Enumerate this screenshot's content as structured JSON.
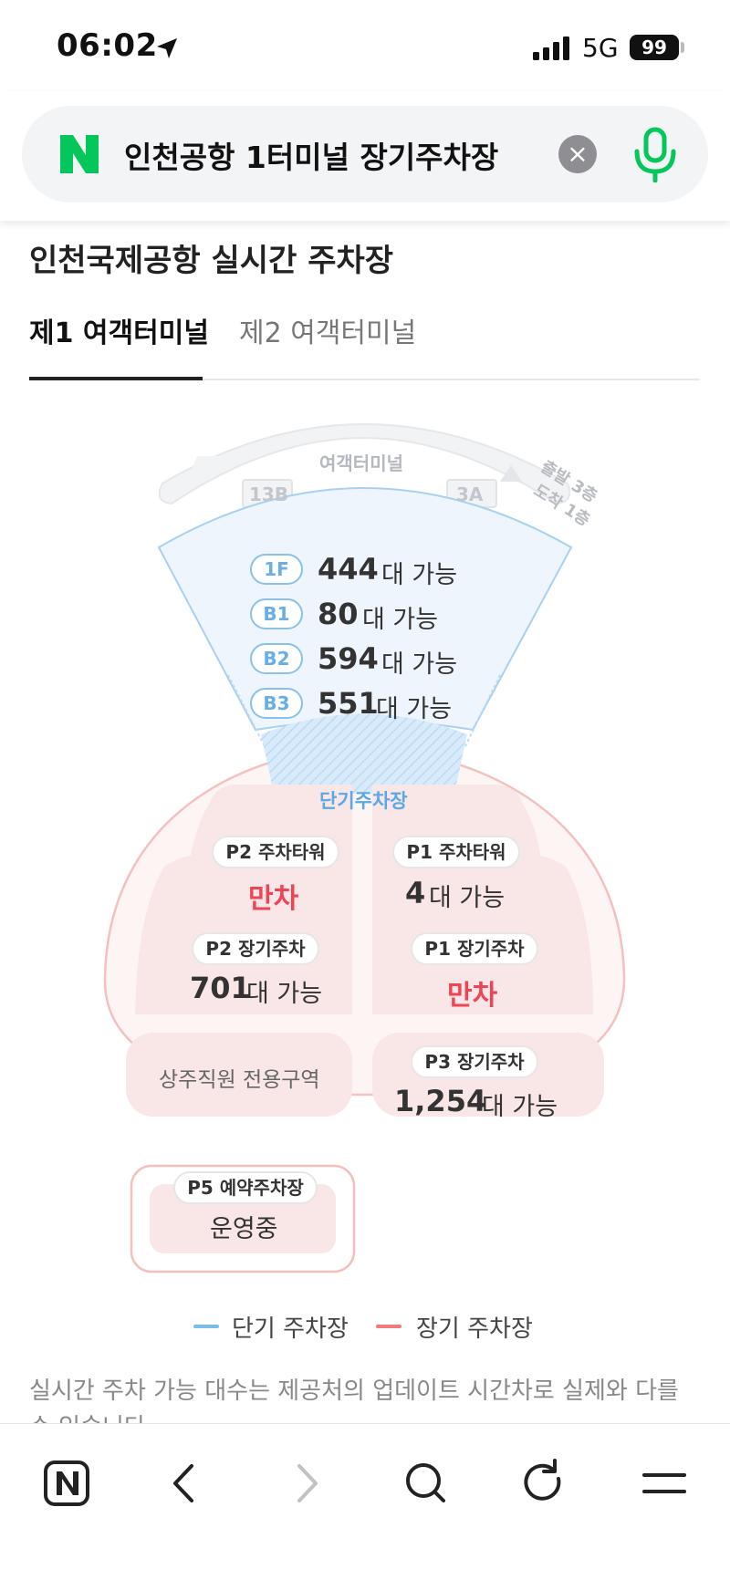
{
  "status_bar": {
    "time": "06:02",
    "network": "5G",
    "battery": "99"
  },
  "search": {
    "query": "인천공항 1터미널 장기주차장"
  },
  "page": {
    "title": "인천국제공항 실시간 주차장"
  },
  "tabs": [
    {
      "label": "제1 여객터미널",
      "active": true
    },
    {
      "label": "제2 여객터미널",
      "active": false
    }
  ],
  "map": {
    "terminal_label": "여객터미널",
    "gate_left": "13B",
    "gate_right": "3A",
    "departure_note": "출발 3층",
    "arrival_note": "도착 1층",
    "short_term_label": "단기주차장",
    "floors": [
      {
        "floor": "1F",
        "count": "444",
        "unit": "대 가능"
      },
      {
        "floor": "B1",
        "count": "80",
        "unit": "대 가능"
      },
      {
        "floor": "B2",
        "count": "594",
        "unit": "대 가능"
      },
      {
        "floor": "B3",
        "count": "551",
        "unit": "대 가능"
      }
    ],
    "lots": {
      "p2_tower": {
        "name": "P2 주차타워",
        "status": "만차"
      },
      "p1_tower": {
        "name": "P1 주차타워",
        "count": "4",
        "unit": "대 가능"
      },
      "p2_long": {
        "name": "P2 장기주차",
        "count": "701",
        "unit": "대 가능"
      },
      "p1_long": {
        "name": "P1 장기주차",
        "status": "만차"
      },
      "staff_area": "상주직원 전용구역",
      "p3_long": {
        "name": "P3 장기주차",
        "count": "1,254",
        "unit": "대 가능"
      },
      "p5_reserve": {
        "name": "P5 예약주차장",
        "status": "운영중"
      }
    }
  },
  "legend": {
    "short_term": "단기 주차장",
    "long_term": "장기 주차장"
  },
  "note": "실시간 주차 가능 대수는 제공처의 업데이트 시간차로 실제와 다를 수 있습니다.",
  "colors": {
    "short_term": "#7dbbe8",
    "long_term": "#f2a3a3",
    "full": "#ee4455",
    "naver_green": "#03c75a"
  }
}
